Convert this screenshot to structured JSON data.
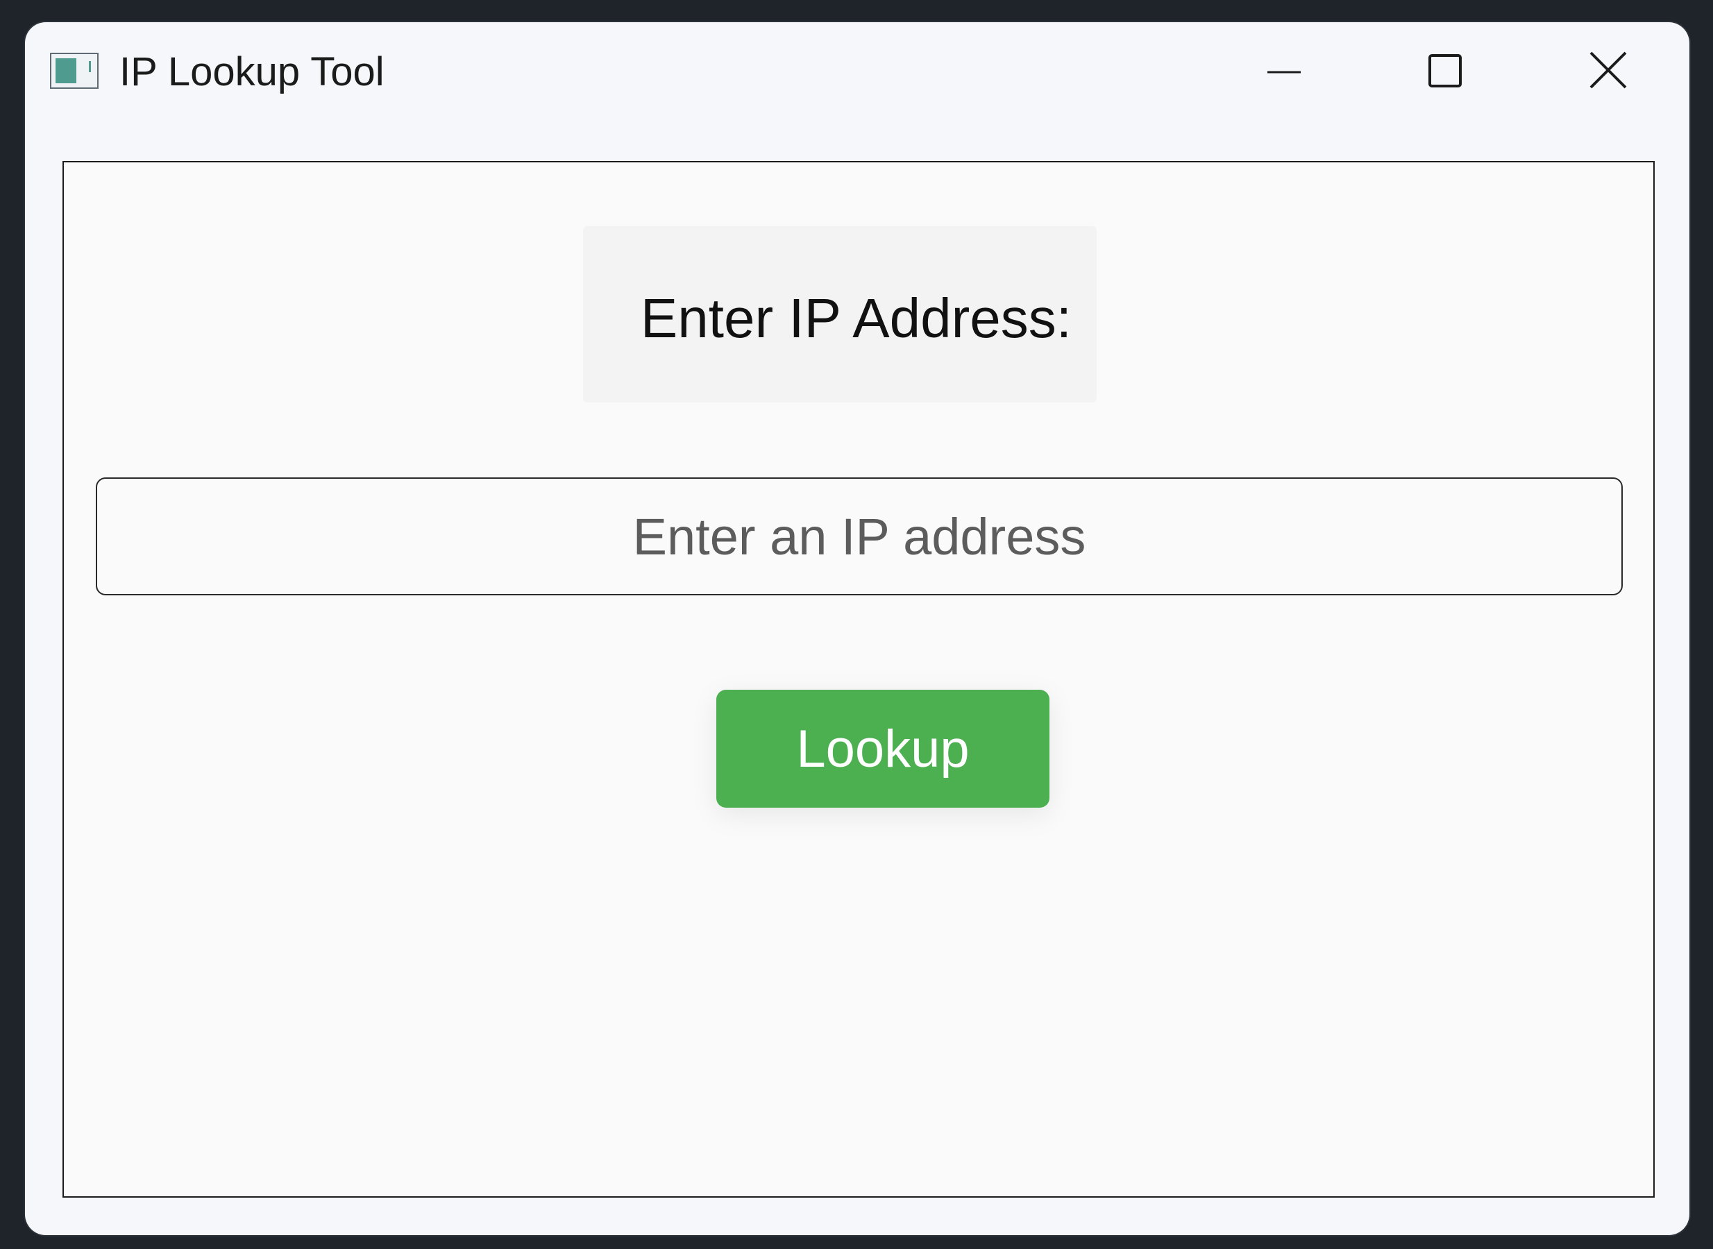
{
  "window": {
    "title": "IP Lookup Tool",
    "controls": {
      "minimize_icon": "minimize-icon",
      "maximize_icon": "maximize-icon",
      "close_icon": "close-icon"
    }
  },
  "form": {
    "label": "Enter IP Address:",
    "input_value": "",
    "input_placeholder": "Enter an IP address",
    "button_label": "Lookup"
  },
  "colors": {
    "accent": "#4caf50",
    "window_background": "#f5f7fa",
    "content_background": "#fafafa"
  }
}
